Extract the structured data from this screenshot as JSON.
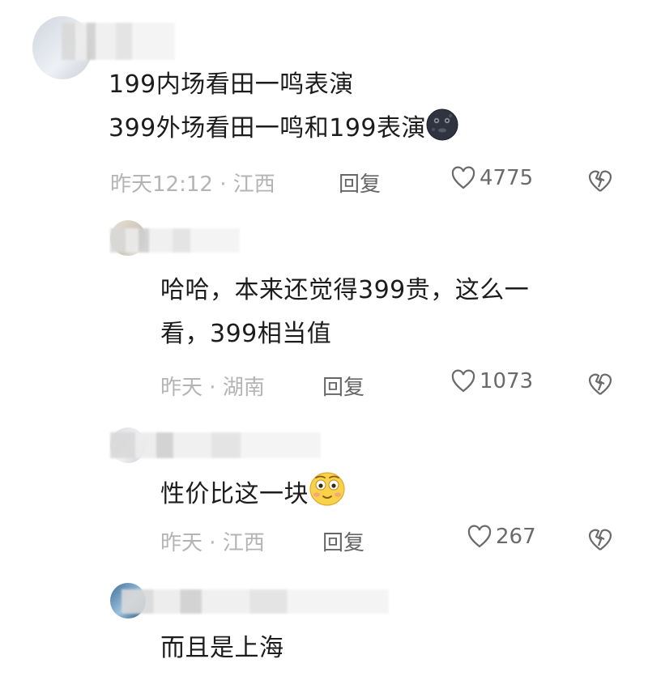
{
  "comments": [
    {
      "lines": [
        "199内场看田一鸣表演",
        "399外场看田一鸣和199表演"
      ],
      "emoji": "moon-face",
      "time": "昨天12:12",
      "location": "江西",
      "reply": "回复",
      "likes": "4775"
    },
    {
      "lines": [
        "哈哈，本来还觉得399贵，这么一",
        "看，399相当值"
      ],
      "time": "昨天",
      "location": "湖南",
      "reply": "回复",
      "likes": "1073"
    },
    {
      "lines": [
        "性价比这一块"
      ],
      "emoji": "flushed-face",
      "time": "昨天",
      "location": "江西",
      "reply": "回复",
      "likes": "267"
    },
    {
      "lines": [
        "而且是上海"
      ]
    }
  ],
  "separator": "·"
}
